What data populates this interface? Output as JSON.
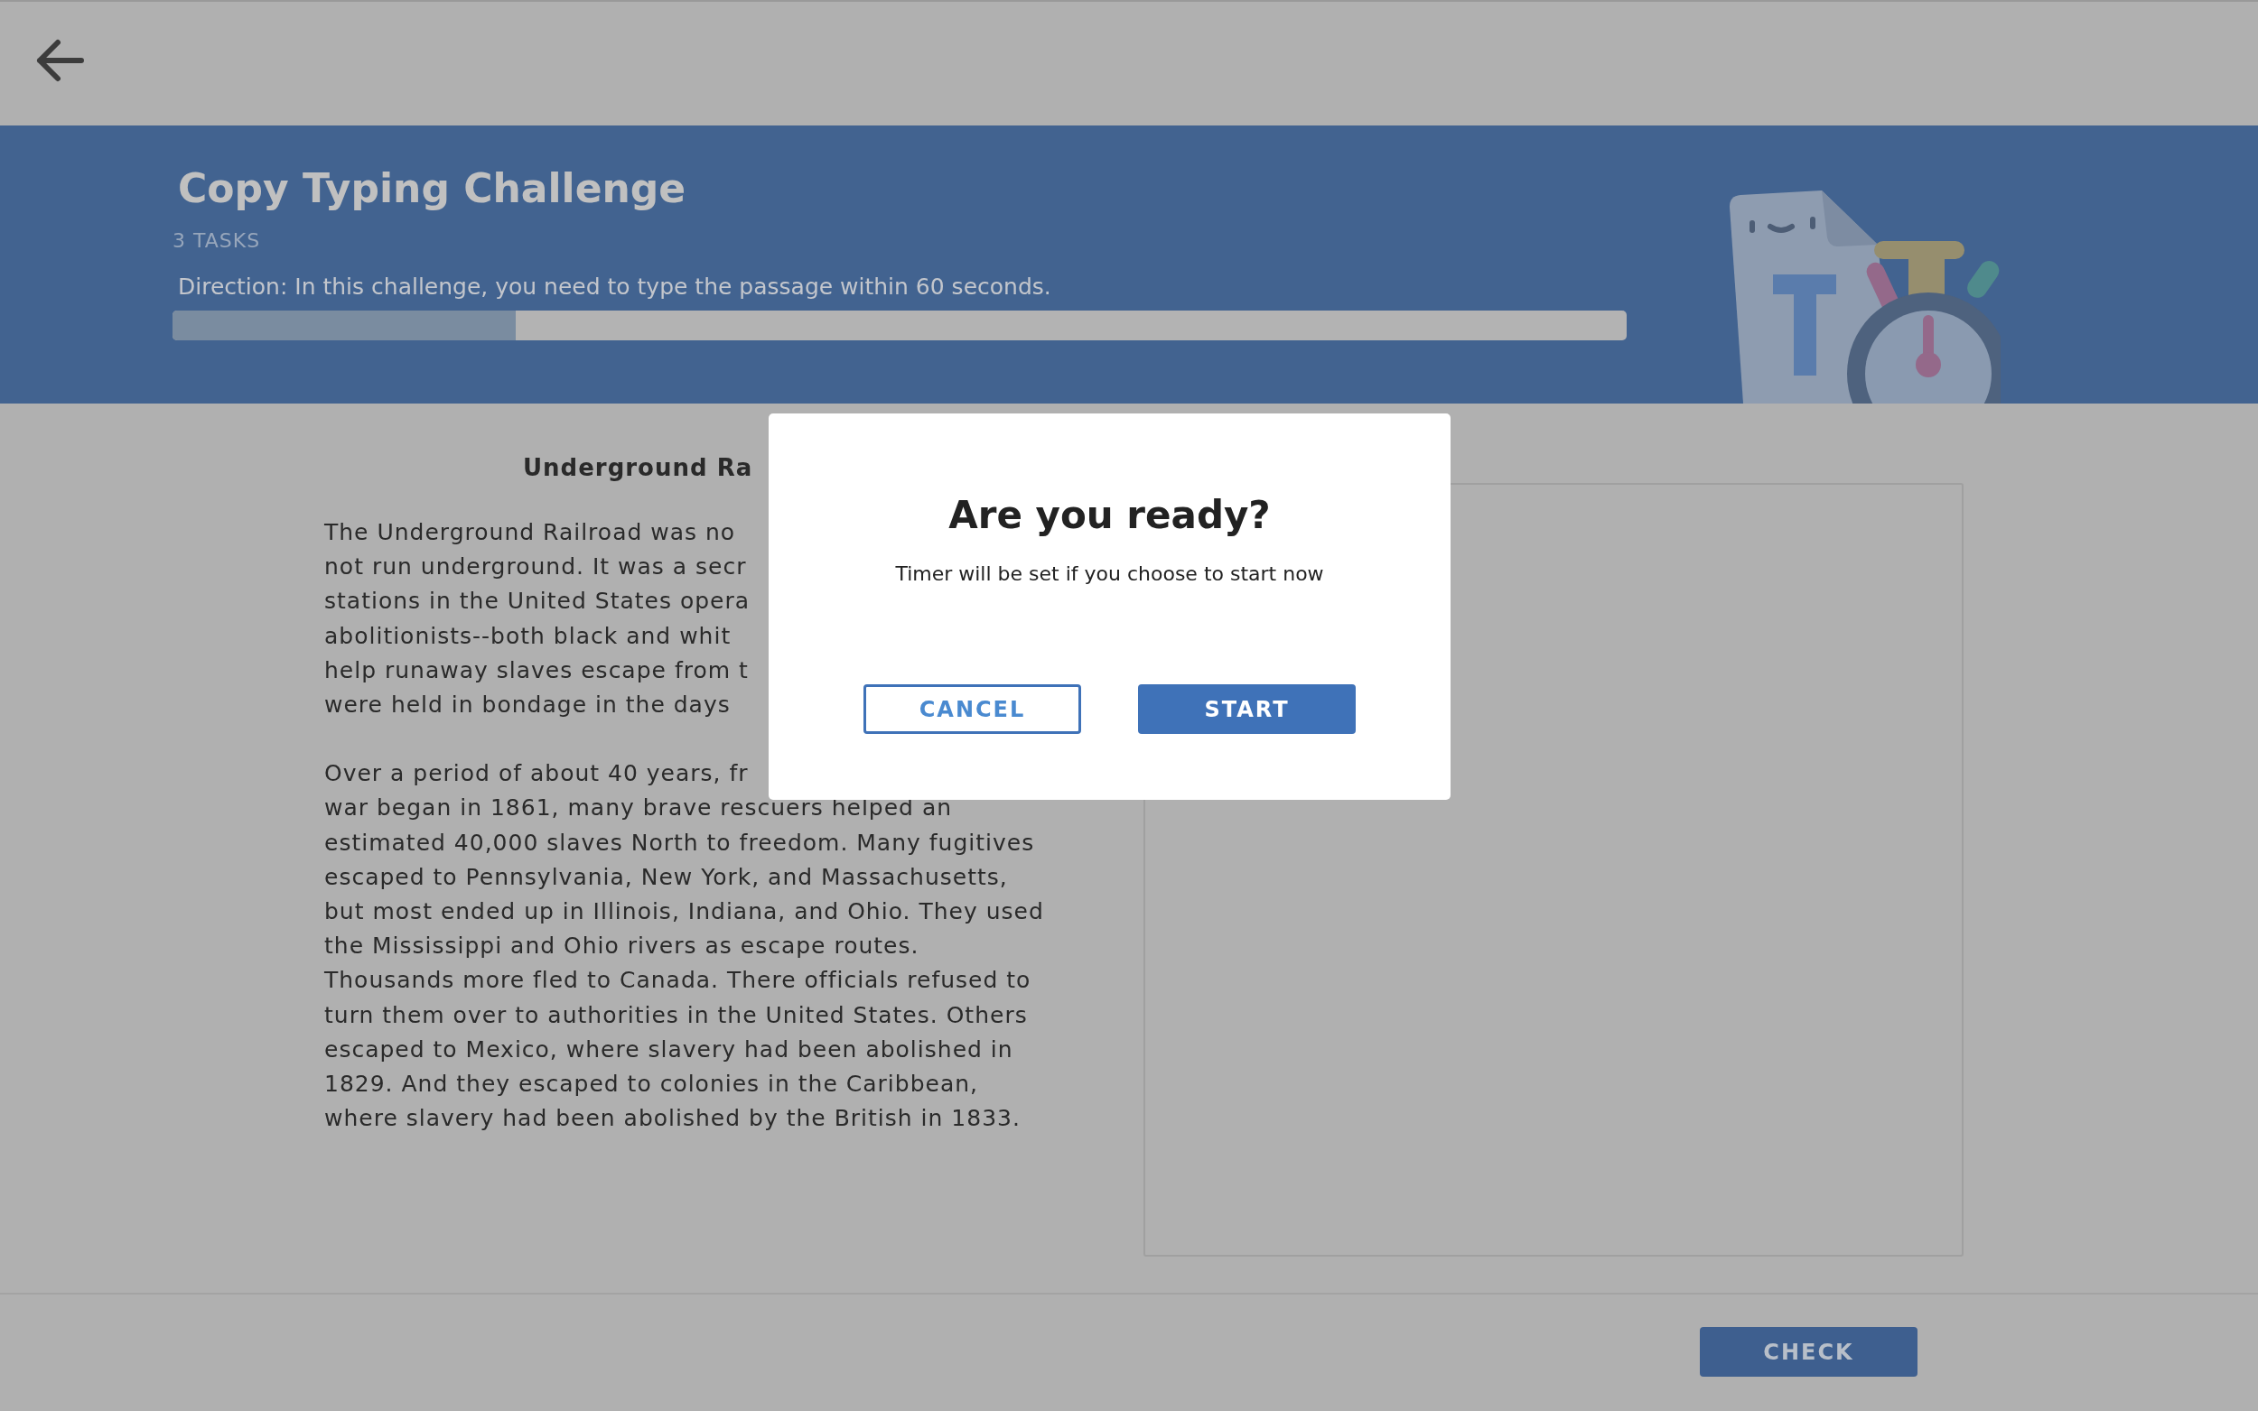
{
  "banner": {
    "title": "Copy Typing Challenge",
    "tasks": "3 TASKS",
    "direction": "Direction: In this challenge, you need to type the passage within 60 seconds.",
    "progress": {
      "level": 0.236
    }
  },
  "passage": {
    "title": "Underground Ra",
    "paragraphs": [
      [
        "The Underground Railroad was no",
        "not run underground. It was a secr",
        "stations in the United States opera",
        "abolitionists--both black and whit",
        "help runaway slaves escape from t",
        "were held in bondage in the days"
      ],
      [
        "Over a period of about 40 years, fr",
        "war began in 1861, many brave rescuers helped an",
        "estimated 40,000 slaves North to freedom. Many fugitives",
        "escaped to Pennsylvania, New York, and Massachusetts,",
        "but most ended up in Illinois, Indiana, and Ohio. They used",
        "the Mississippi and Ohio rivers as escape routes.",
        "Thousands more fled to Canada. There officials refused to",
        "turn them over to authorities in the United States. Others",
        "escaped to Mexico, where slavery had been abolished in",
        "1829. And they escaped to colonies in the Caribbean,",
        "where slavery had been abolished by the British in 1833."
      ]
    ]
  },
  "footer": {
    "button": "CHECK"
  },
  "dialog": {
    "title": "Are you ready?",
    "message": "Timer will be set if you choose to start now",
    "buttons": [
      {
        "label": "CANCEL",
        "kind": "outline"
      },
      {
        "label": "START",
        "kind": "filled"
      }
    ]
  }
}
